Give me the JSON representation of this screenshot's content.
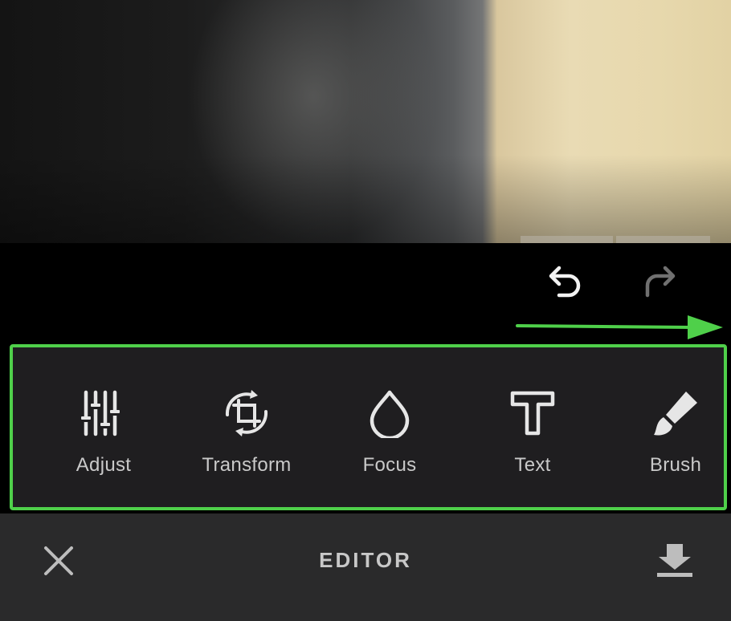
{
  "colors": {
    "accent_outline": "#4fd04a",
    "tools_background": "#1f1e20",
    "bottom_bar_background": "#2a2a2b",
    "label_color": "#c9c9c9",
    "icon_color": "#e6e6e6",
    "disabled_icon_color": "#6f6f6f"
  },
  "history": {
    "undo_icon": "undo-icon",
    "redo_icon": "redo-icon",
    "redo_enabled": false
  },
  "tools": [
    {
      "label": "Adjust",
      "icon": "sliders-icon"
    },
    {
      "label": "Transform",
      "icon": "crop-rotate-icon"
    },
    {
      "label": "Focus",
      "icon": "droplet-icon"
    },
    {
      "label": "Text",
      "icon": "text-t-icon"
    },
    {
      "label": "Brush",
      "icon": "brush-icon"
    }
  ],
  "bottom_bar": {
    "title": "EDITOR",
    "close_icon": "close-icon",
    "save_icon": "download-icon"
  }
}
